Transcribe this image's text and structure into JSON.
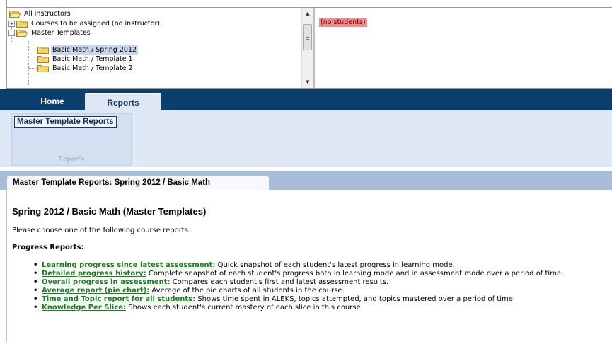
{
  "tree": {
    "items": [
      {
        "label": "All instructors",
        "expander": ""
      },
      {
        "label": "Courses to be assigned (no instructor)",
        "expander": "+"
      },
      {
        "label": "Master Templates",
        "expander": "−"
      },
      {
        "label": "Basic Math / Spring 2012",
        "selected": true
      },
      {
        "label": "Basic Math / Template 1"
      },
      {
        "label": "Basic Math / Template 2"
      }
    ]
  },
  "students_panel": {
    "empty_text": "(no students)"
  },
  "nav": {
    "tabs": [
      {
        "label": "Home"
      },
      {
        "label": "Reports",
        "active": true
      }
    ]
  },
  "ribbon": {
    "button_label": "Master Template Reports",
    "group_label": "Reports"
  },
  "page": {
    "header_tab": "Master Template Reports: Spring 2012 / Basic Math",
    "course_title": "Spring 2012 / Basic Math (Master Templates)",
    "intro": "Please choose one of the following course reports.",
    "section_heading": "Progress Reports:",
    "reports": [
      {
        "link": "Learning progress since latest assessment:",
        "desc": " Quick snapshot of each student's latest progress in learning mode."
      },
      {
        "link": "Detailed progress history:",
        "desc": " Complete snapshot of each student's progress both in learning mode and in assessment mode over a period of time."
      },
      {
        "link": "Overall progress in assessment:",
        "desc": " Compares each student's first and latest assessment results."
      },
      {
        "link": "Average report (pie chart):",
        "desc": " Average of the pie charts of all students in the course."
      },
      {
        "link": "Time and Topic report for all students:",
        "desc": " Shows time spent in ALEKS, topics attempted, and topics mastered over a period of time."
      },
      {
        "link": "Knowledge Per Slice:",
        "desc": " Shows each student's current mastery of each slice in this course."
      }
    ]
  },
  "colors": {
    "nav_bar": "#0b3d6f",
    "link": "#1d7a1d",
    "no_students_bg": "#f08c8c",
    "selected_item": "#c7d6ea"
  }
}
